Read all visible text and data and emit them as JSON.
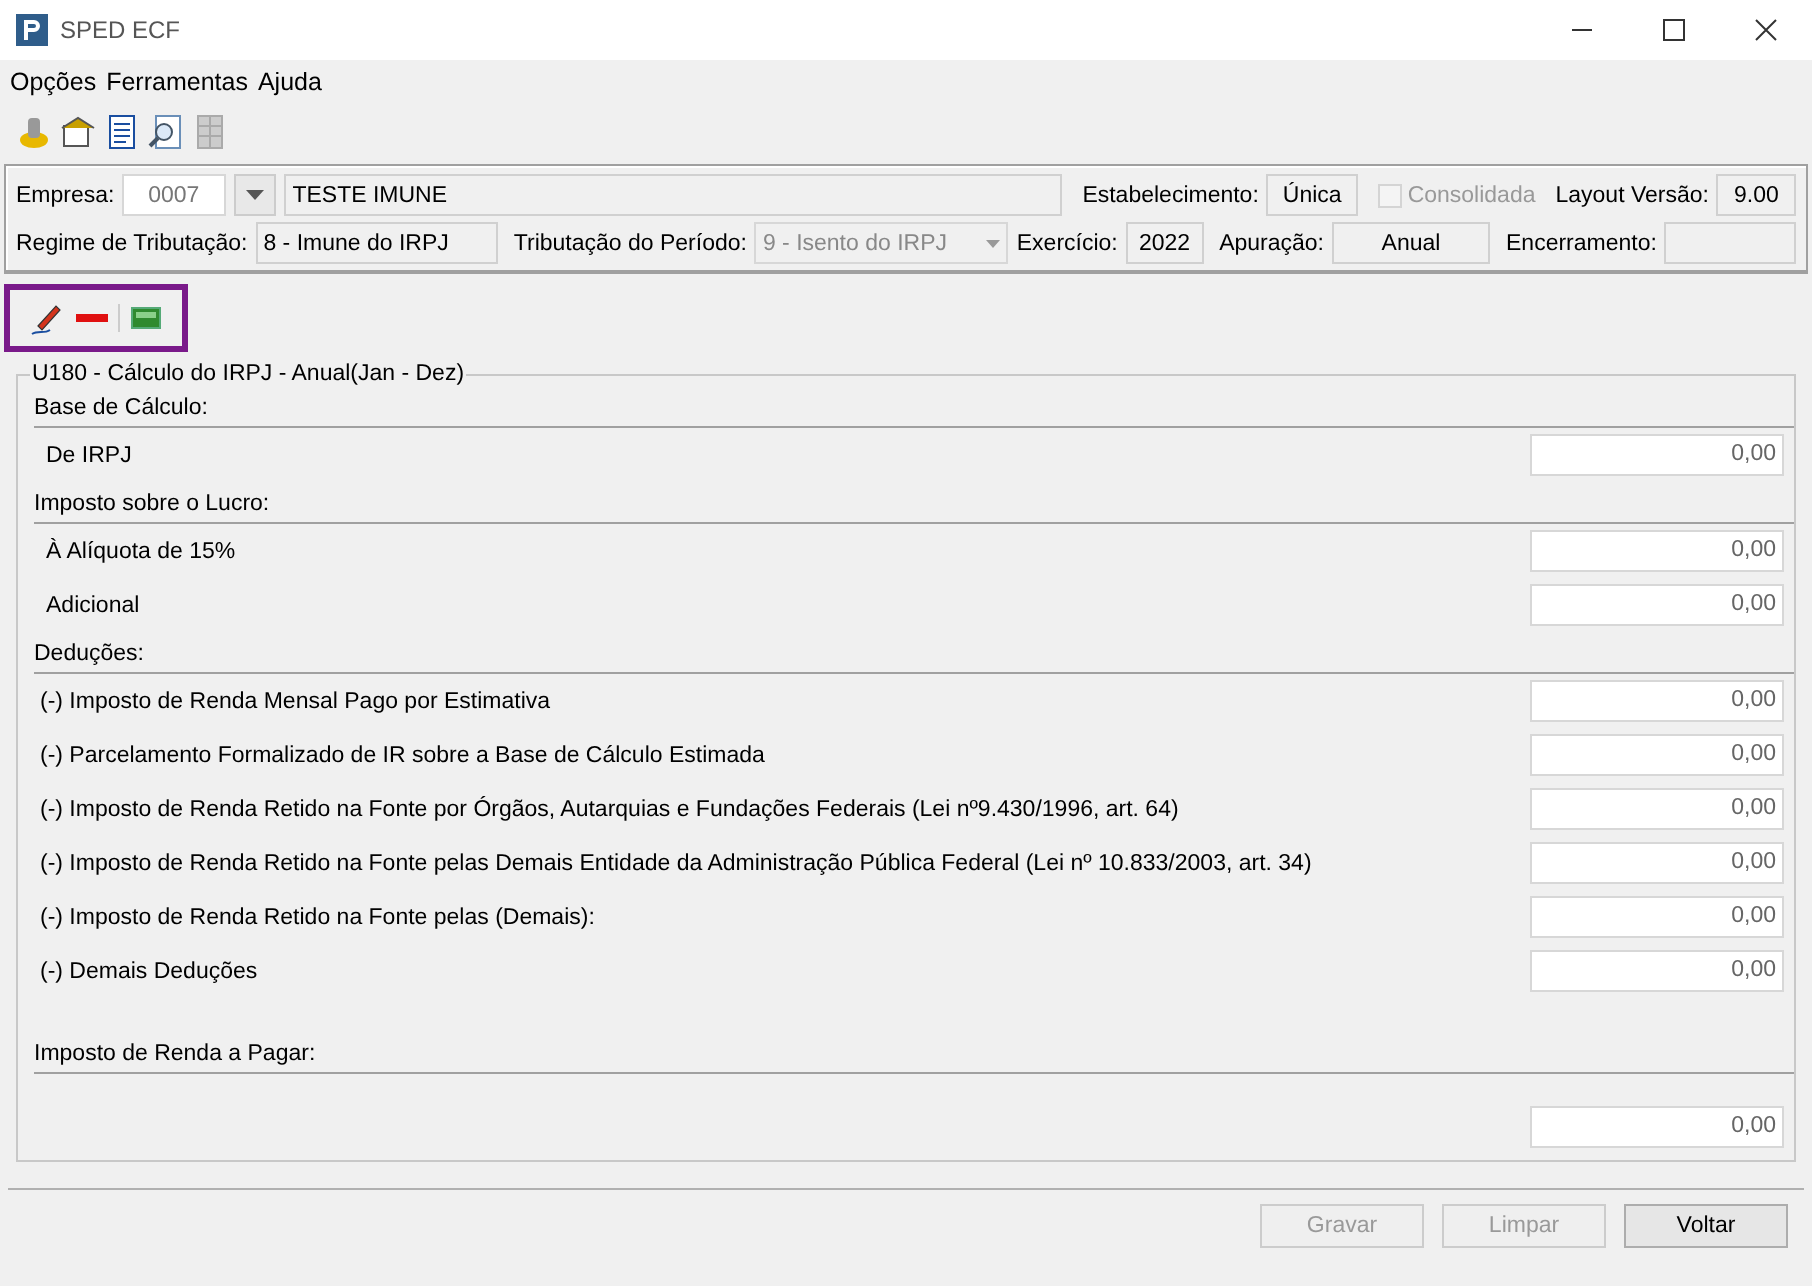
{
  "window": {
    "title": "SPED ECF"
  },
  "menu": [
    "Opções",
    "Ferramentas",
    "Ajuda"
  ],
  "header": {
    "empresa": {
      "label": "Empresa:",
      "code": "0007",
      "name": "TESTE IMUNE"
    },
    "estabelecimento": {
      "label": "Estabelecimento:",
      "value": "Única"
    },
    "consolidada": {
      "label": "Consolidada",
      "checked": false,
      "disabled": true
    },
    "layout": {
      "label": "Layout Versão:",
      "value": "9.00"
    },
    "regime": {
      "label": "Regime de Tributação:",
      "value": "8 - Imune do IRPJ"
    },
    "tributacao": {
      "label": "Tributação do Período:",
      "value": "9 - Isento do IRPJ",
      "disabled": true
    },
    "exercicio": {
      "label": "Exercício:",
      "value": "2022"
    },
    "apuracao": {
      "label": "Apuração:",
      "value": "Anual"
    },
    "encerramento": {
      "label": "Encerramento:"
    }
  },
  "group": {
    "title": "U180 - Cálculo do IRPJ - Anual(Jan - Dez)",
    "sections": [
      {
        "heading": "Base de Cálculo:",
        "rows": [
          {
            "label": "De IRPJ",
            "value": "0,00",
            "indent": true
          }
        ]
      },
      {
        "heading": "Imposto sobre o Lucro:",
        "rows": [
          {
            "label": "À Alíquota de 15%",
            "value": "0,00",
            "indent": true
          },
          {
            "label": "Adicional",
            "value": "0,00",
            "indent": true
          }
        ]
      },
      {
        "heading": "Deduções:",
        "rows": [
          {
            "label": "(-) Imposto de Renda Mensal Pago por Estimativa",
            "value": "0,00",
            "indent": false
          },
          {
            "label": "(-) Parcelamento Formalizado de IR sobre a Base de Cálculo Estimada",
            "value": "0,00",
            "indent": false
          },
          {
            "label": "(-) Imposto de Renda Retido na Fonte por Órgãos, Autarquias e Fundações Federais (Lei nº9.430/1996, art. 64)",
            "value": "0,00",
            "indent": false
          },
          {
            "label": "(-) Imposto de Renda Retido na Fonte pelas Demais Entidade da Administração Pública Federal (Lei nº 10.833/2003, art. 34)",
            "value": "0,00",
            "indent": false
          },
          {
            "label": "(-) Imposto de Renda Retido na Fonte pelas (Demais):",
            "value": "0,00",
            "indent": false
          },
          {
            "label": "(-) Demais Deduções",
            "value": "0,00",
            "indent": false
          }
        ]
      },
      {
        "heading": "Imposto de Renda a Pagar:",
        "rows": [
          {
            "value": "0,00"
          }
        ]
      }
    ]
  },
  "buttons": [
    {
      "label": "Gravar",
      "disabled": true
    },
    {
      "label": "Limpar",
      "disabled": true
    },
    {
      "label": "Voltar",
      "disabled": false
    }
  ]
}
